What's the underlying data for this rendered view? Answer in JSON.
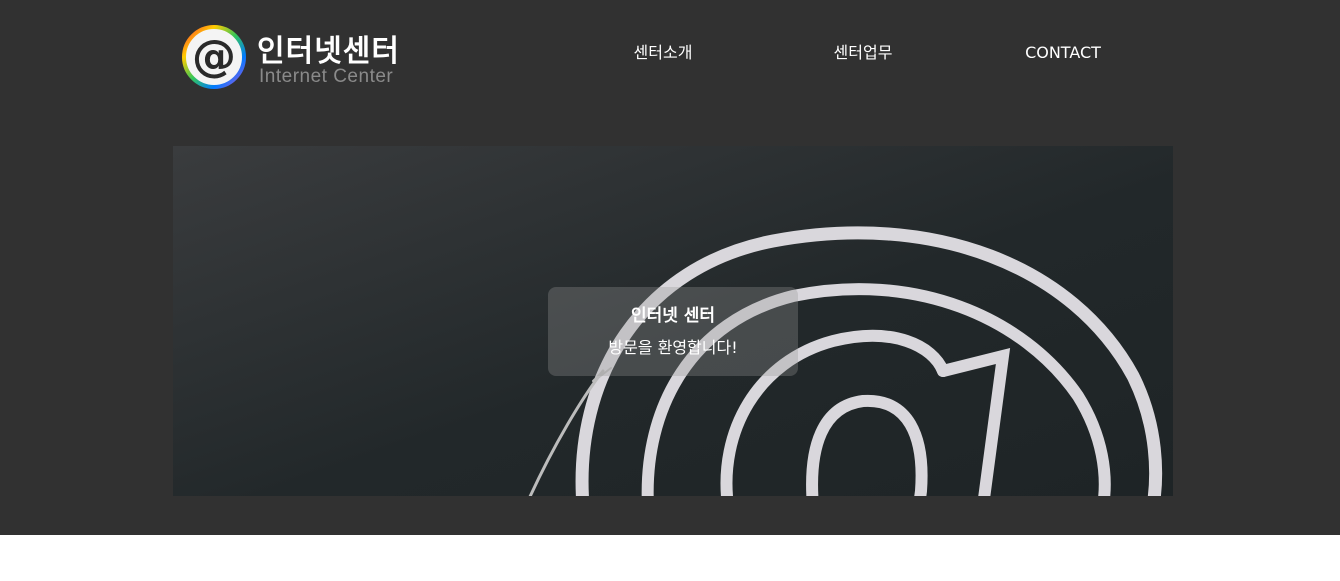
{
  "header": {
    "logo": {
      "title": "인터넷센터",
      "subtitle": "Internet Center",
      "icon": "at-sign-icon"
    },
    "nav": [
      {
        "label": "센터소개"
      },
      {
        "label": "센터업무"
      },
      {
        "label": "CONTACT"
      }
    ]
  },
  "hero": {
    "image": "embroidered-at-sign-on-dark-fabric",
    "welcome": {
      "title": "인터넷 센터",
      "subtitle": "방문을 환영합니다!"
    }
  },
  "colors": {
    "header_bg": "#313131",
    "page_bg": "#ffffff",
    "nav_text": "#ffffff",
    "logo_subtitle": "#8a8a8a"
  }
}
